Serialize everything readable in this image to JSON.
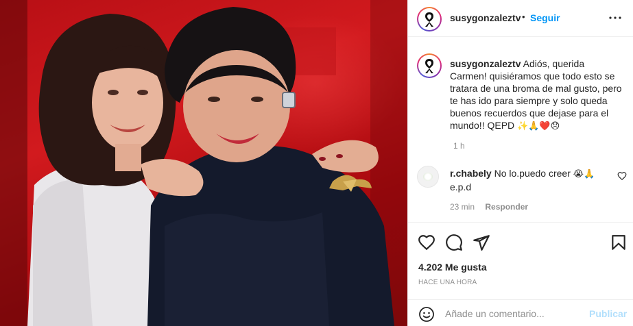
{
  "post": {
    "username": "susygonzaleztv",
    "follow_label": "Seguir",
    "separator": "•",
    "caption": {
      "username": "susygonzaleztv",
      "text": "Adiós, querida Carmen! quisiéramos que todo esto se tratara de una broma de mal gusto, pero te has ido para siempre y solo queda buenos recuerdos que dejase para el mundo!! QEPD",
      "emojis": "✨🙏❤️😞",
      "time": "1 h"
    },
    "comments": [
      {
        "username": "r.chabely",
        "text": "No lo.puedo creer",
        "emojis": "😭🙏",
        "text_line2": "e.p.d",
        "time": "23 min",
        "reply_label": "Responder"
      }
    ],
    "likes": "4.202 Me gusta",
    "posted_ago": "HACE UNA HORA",
    "comment_placeholder": "Añade un comentario...",
    "publish_label": "Publicar"
  },
  "icons": {
    "avatar": "black-ribbon-icon",
    "more": "more-options-icon",
    "like": "heart-icon",
    "comment": "comment-icon",
    "share": "share-icon",
    "save": "bookmark-icon",
    "emoji": "emoji-icon",
    "comment_like": "small-heart-icon"
  },
  "colors": {
    "accent": "#0095f6",
    "publish_disabled": "#b2dffc",
    "secondary_text": "#8e8e8e"
  }
}
